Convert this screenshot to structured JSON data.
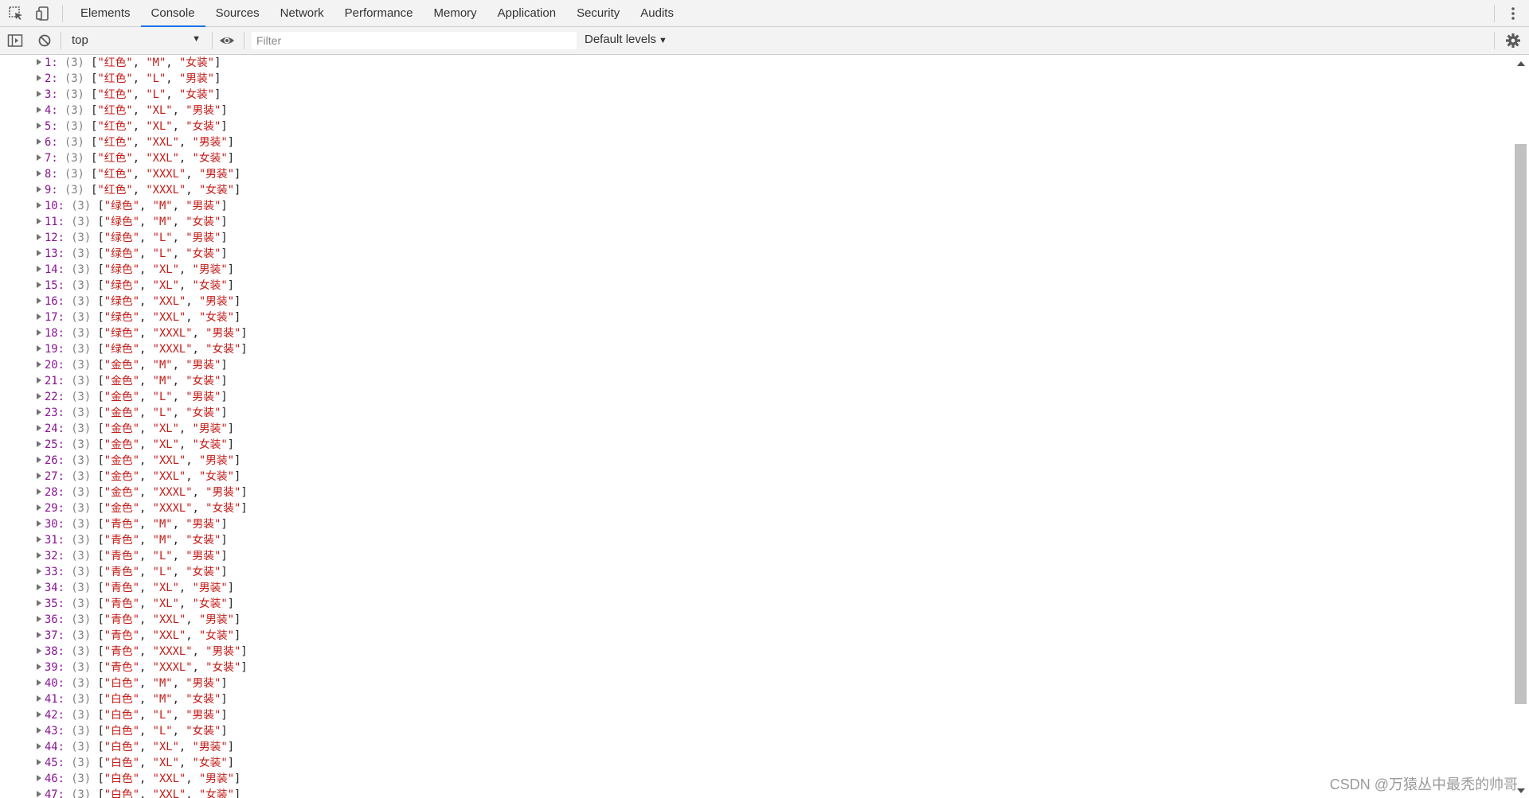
{
  "devtools": {
    "tabs": [
      "Elements",
      "Console",
      "Sources",
      "Network",
      "Performance",
      "Memory",
      "Application",
      "Security",
      "Audits"
    ],
    "active_tab": "Console"
  },
  "toolbar": {
    "context": "top",
    "filter_placeholder": "Filter",
    "levels": "Default levels"
  },
  "console_rows": [
    {
      "index": "1",
      "len": "(3)",
      "values": [
        "红色",
        "M",
        "女装"
      ]
    },
    {
      "index": "2",
      "len": "(3)",
      "values": [
        "红色",
        "L",
        "男装"
      ]
    },
    {
      "index": "3",
      "len": "(3)",
      "values": [
        "红色",
        "L",
        "女装"
      ]
    },
    {
      "index": "4",
      "len": "(3)",
      "values": [
        "红色",
        "XL",
        "男装"
      ]
    },
    {
      "index": "5",
      "len": "(3)",
      "values": [
        "红色",
        "XL",
        "女装"
      ]
    },
    {
      "index": "6",
      "len": "(3)",
      "values": [
        "红色",
        "XXL",
        "男装"
      ]
    },
    {
      "index": "7",
      "len": "(3)",
      "values": [
        "红色",
        "XXL",
        "女装"
      ]
    },
    {
      "index": "8",
      "len": "(3)",
      "values": [
        "红色",
        "XXXL",
        "男装"
      ]
    },
    {
      "index": "9",
      "len": "(3)",
      "values": [
        "红色",
        "XXXL",
        "女装"
      ]
    },
    {
      "index": "10",
      "len": "(3)",
      "values": [
        "绿色",
        "M",
        "男装"
      ]
    },
    {
      "index": "11",
      "len": "(3)",
      "values": [
        "绿色",
        "M",
        "女装"
      ]
    },
    {
      "index": "12",
      "len": "(3)",
      "values": [
        "绿色",
        "L",
        "男装"
      ]
    },
    {
      "index": "13",
      "len": "(3)",
      "values": [
        "绿色",
        "L",
        "女装"
      ]
    },
    {
      "index": "14",
      "len": "(3)",
      "values": [
        "绿色",
        "XL",
        "男装"
      ]
    },
    {
      "index": "15",
      "len": "(3)",
      "values": [
        "绿色",
        "XL",
        "女装"
      ]
    },
    {
      "index": "16",
      "len": "(3)",
      "values": [
        "绿色",
        "XXL",
        "男装"
      ]
    },
    {
      "index": "17",
      "len": "(3)",
      "values": [
        "绿色",
        "XXL",
        "女装"
      ]
    },
    {
      "index": "18",
      "len": "(3)",
      "values": [
        "绿色",
        "XXXL",
        "男装"
      ]
    },
    {
      "index": "19",
      "len": "(3)",
      "values": [
        "绿色",
        "XXXL",
        "女装"
      ]
    },
    {
      "index": "20",
      "len": "(3)",
      "values": [
        "金色",
        "M",
        "男装"
      ]
    },
    {
      "index": "21",
      "len": "(3)",
      "values": [
        "金色",
        "M",
        "女装"
      ]
    },
    {
      "index": "22",
      "len": "(3)",
      "values": [
        "金色",
        "L",
        "男装"
      ]
    },
    {
      "index": "23",
      "len": "(3)",
      "values": [
        "金色",
        "L",
        "女装"
      ]
    },
    {
      "index": "24",
      "len": "(3)",
      "values": [
        "金色",
        "XL",
        "男装"
      ]
    },
    {
      "index": "25",
      "len": "(3)",
      "values": [
        "金色",
        "XL",
        "女装"
      ]
    },
    {
      "index": "26",
      "len": "(3)",
      "values": [
        "金色",
        "XXL",
        "男装"
      ]
    },
    {
      "index": "27",
      "len": "(3)",
      "values": [
        "金色",
        "XXL",
        "女装"
      ]
    },
    {
      "index": "28",
      "len": "(3)",
      "values": [
        "金色",
        "XXXL",
        "男装"
      ]
    },
    {
      "index": "29",
      "len": "(3)",
      "values": [
        "金色",
        "XXXL",
        "女装"
      ]
    },
    {
      "index": "30",
      "len": "(3)",
      "values": [
        "青色",
        "M",
        "男装"
      ]
    },
    {
      "index": "31",
      "len": "(3)",
      "values": [
        "青色",
        "M",
        "女装"
      ]
    },
    {
      "index": "32",
      "len": "(3)",
      "values": [
        "青色",
        "L",
        "男装"
      ]
    },
    {
      "index": "33",
      "len": "(3)",
      "values": [
        "青色",
        "L",
        "女装"
      ]
    },
    {
      "index": "34",
      "len": "(3)",
      "values": [
        "青色",
        "XL",
        "男装"
      ]
    },
    {
      "index": "35",
      "len": "(3)",
      "values": [
        "青色",
        "XL",
        "女装"
      ]
    },
    {
      "index": "36",
      "len": "(3)",
      "values": [
        "青色",
        "XXL",
        "男装"
      ]
    },
    {
      "index": "37",
      "len": "(3)",
      "values": [
        "青色",
        "XXL",
        "女装"
      ]
    },
    {
      "index": "38",
      "len": "(3)",
      "values": [
        "青色",
        "XXXL",
        "男装"
      ]
    },
    {
      "index": "39",
      "len": "(3)",
      "values": [
        "青色",
        "XXXL",
        "女装"
      ]
    },
    {
      "index": "40",
      "len": "(3)",
      "values": [
        "白色",
        "M",
        "男装"
      ]
    },
    {
      "index": "41",
      "len": "(3)",
      "values": [
        "白色",
        "M",
        "女装"
      ]
    },
    {
      "index": "42",
      "len": "(3)",
      "values": [
        "白色",
        "L",
        "男装"
      ]
    },
    {
      "index": "43",
      "len": "(3)",
      "values": [
        "白色",
        "L",
        "女装"
      ]
    },
    {
      "index": "44",
      "len": "(3)",
      "values": [
        "白色",
        "XL",
        "男装"
      ]
    },
    {
      "index": "45",
      "len": "(3)",
      "values": [
        "白色",
        "XL",
        "女装"
      ]
    },
    {
      "index": "46",
      "len": "(3)",
      "values": [
        "白色",
        "XXL",
        "男装"
      ]
    },
    {
      "index": "47",
      "len": "(3)",
      "values": [
        "白色",
        "XXL",
        "女装"
      ]
    }
  ],
  "watermark": "CSDN @万猿丛中最秃的帅哥",
  "colors": {
    "index": "#881391",
    "string": "#c41a16",
    "length": "#7f7f7f",
    "active_tab_underline": "#1a73e8"
  }
}
